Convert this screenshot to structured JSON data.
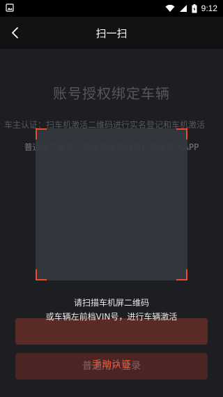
{
  "status_bar": {
    "time": "9:12"
  },
  "header": {
    "title": "扫一扫"
  },
  "underlay": {
    "title": "账号授权绑定车辆",
    "owner_line": "车主认证：扫车机激活二维码进行实名登记和车机激活",
    "user_line": "普通用户登录：直接使用普通用户登录进入APP",
    "button_owner": "",
    "button_user": "普通用户登录"
  },
  "scanner": {
    "hint_line1": "请扫描车机屏二维码",
    "hint_line2": "或车辆左前档VIN号，进行车辆激活",
    "manual_label": "手动认证"
  },
  "colors": {
    "accent": "#f04a2c"
  }
}
